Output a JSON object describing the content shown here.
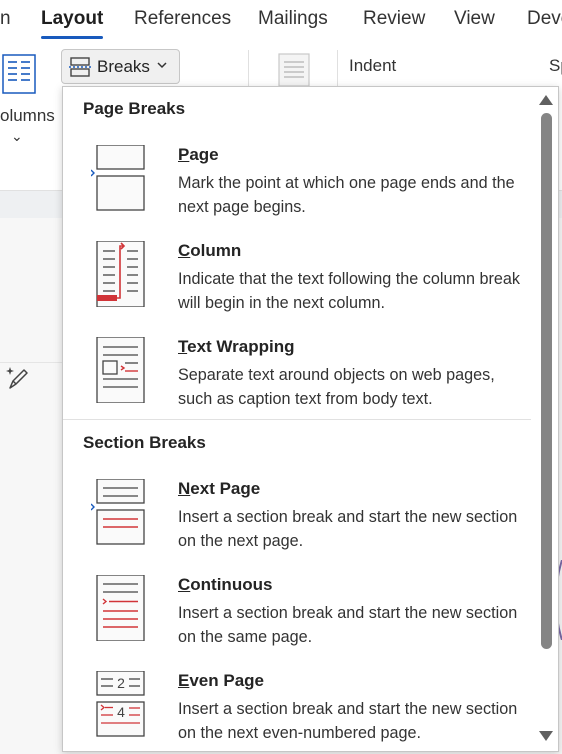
{
  "ribbon": {
    "tabs": [
      {
        "label": "n"
      },
      {
        "label": "Layout",
        "active": true
      },
      {
        "label": "References"
      },
      {
        "label": "Mailings"
      },
      {
        "label": "Review"
      },
      {
        "label": "View"
      },
      {
        "label": "Deve"
      }
    ],
    "columns_label": "olumns",
    "breaks_label": "Breaks",
    "indent_label": "Indent",
    "spacing_label": "Sp"
  },
  "menu": {
    "page_breaks_header": "Page Breaks",
    "section_breaks_header": "Section Breaks",
    "items": [
      {
        "icon": "page-break-icon",
        "title_key": "P",
        "title_rest": "age",
        "description": "Mark the point at which one page ends and the next page begins."
      },
      {
        "icon": "column-break-icon",
        "title_key": "C",
        "title_rest": "olumn",
        "description": "Indicate that the text following the column break will begin in the next column."
      },
      {
        "icon": "text-wrapping-icon",
        "title_key": "T",
        "title_rest": "ext Wrapping",
        "description": "Separate text around objects on web pages, such as caption text from body text."
      },
      {
        "icon": "next-page-icon",
        "title_key": "N",
        "title_rest": "ext Page",
        "description": "Insert a section break and start the new section on the next page."
      },
      {
        "icon": "continuous-icon",
        "title_key": "C",
        "title_rest": "ontinuous",
        "description": "Insert a section break and start the new section on the same page."
      },
      {
        "icon": "even-page-icon",
        "title_key": "E",
        "title_rest": "ven Page",
        "description": "Insert a section break and start the new section on the next even-numbered page.",
        "icon_numbers": [
          "2",
          "4"
        ]
      }
    ]
  },
  "colors": {
    "accent": "#185abd",
    "break_red": "#d13438",
    "scroll_thumb": "#858585"
  }
}
